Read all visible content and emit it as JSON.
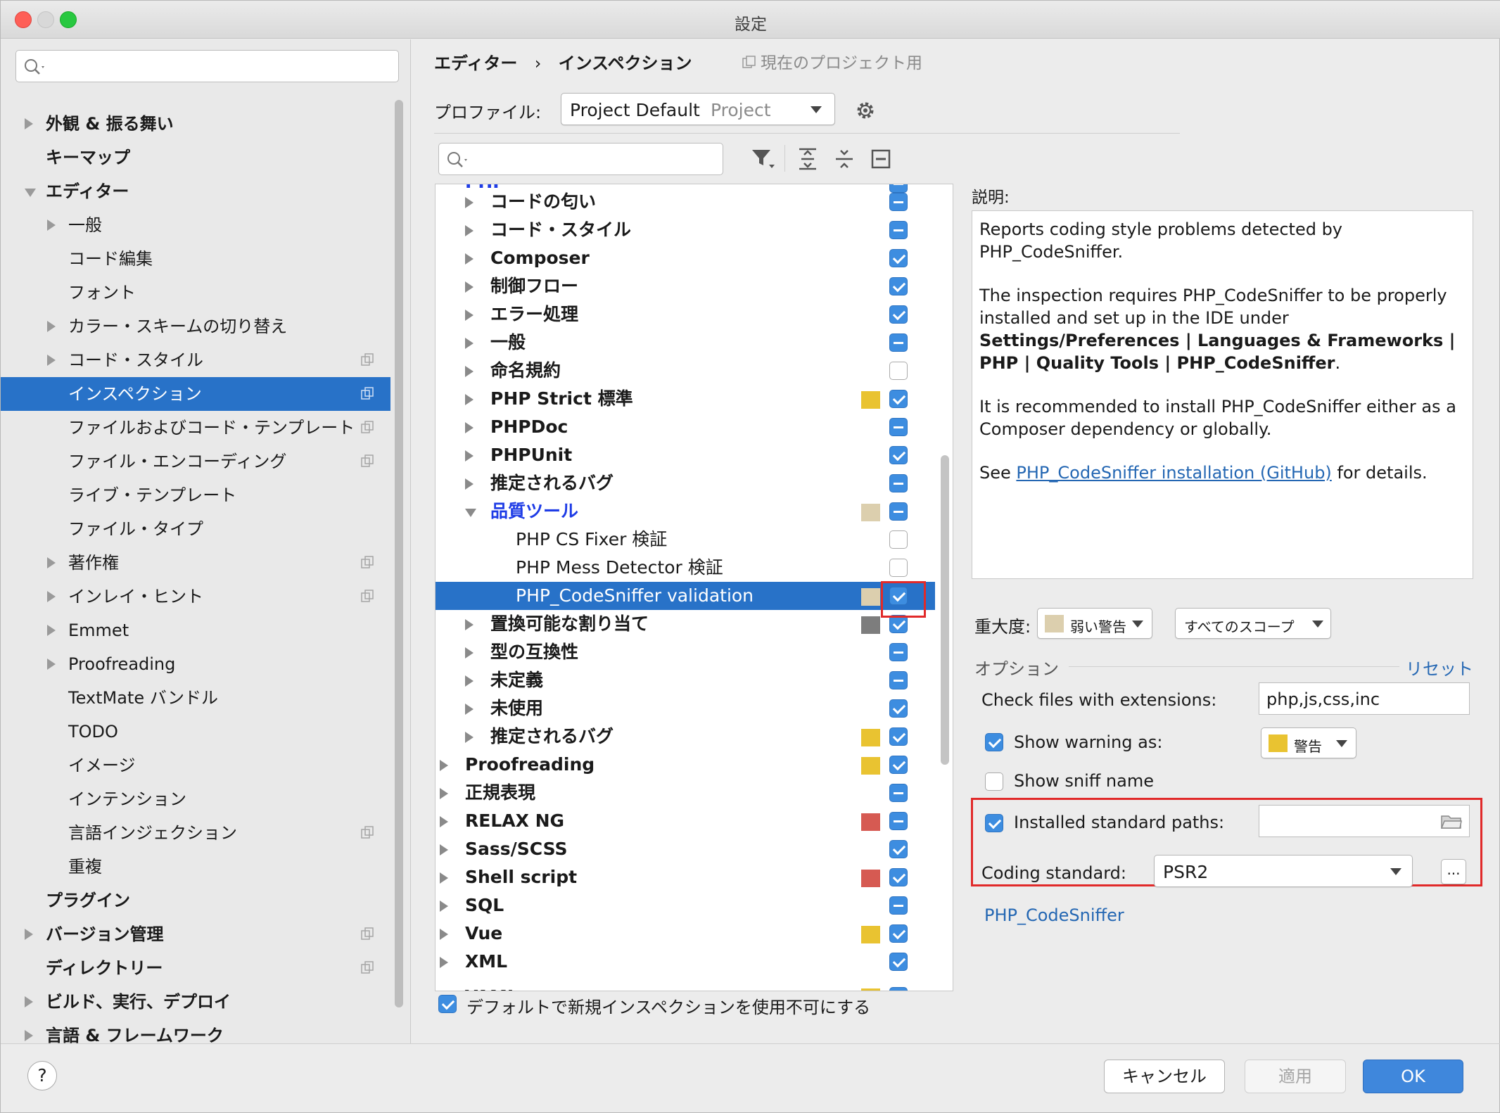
{
  "window": {
    "title": "設定"
  },
  "sidebar": {
    "search_placeholder": "",
    "items": [
      {
        "label": "外観 & 振る舞い",
        "bold": true,
        "indent": 0,
        "arrow": "closed",
        "proj": false
      },
      {
        "label": "キーマップ",
        "bold": true,
        "indent": 0,
        "arrow": "none",
        "proj": false
      },
      {
        "label": "エディター",
        "bold": true,
        "indent": 0,
        "arrow": "open",
        "proj": false
      },
      {
        "label": "一般",
        "bold": false,
        "indent": 1,
        "arrow": "closed",
        "proj": false
      },
      {
        "label": "コード編集",
        "bold": false,
        "indent": 1,
        "arrow": "none",
        "proj": false
      },
      {
        "label": "フォント",
        "bold": false,
        "indent": 1,
        "arrow": "none",
        "proj": false
      },
      {
        "label": "カラー・スキームの切り替え",
        "bold": false,
        "indent": 1,
        "arrow": "closed",
        "proj": false
      },
      {
        "label": "コード・スタイル",
        "bold": false,
        "indent": 1,
        "arrow": "closed",
        "proj": true
      },
      {
        "label": "インスペクション",
        "bold": false,
        "indent": 1,
        "arrow": "none",
        "proj": true,
        "selected": true
      },
      {
        "label": "ファイルおよびコード・テンプレート",
        "bold": false,
        "indent": 1,
        "arrow": "none",
        "proj": true
      },
      {
        "label": "ファイル・エンコーディング",
        "bold": false,
        "indent": 1,
        "arrow": "none",
        "proj": true
      },
      {
        "label": "ライブ・テンプレート",
        "bold": false,
        "indent": 1,
        "arrow": "none",
        "proj": false
      },
      {
        "label": "ファイル・タイプ",
        "bold": false,
        "indent": 1,
        "arrow": "none",
        "proj": false
      },
      {
        "label": "著作権",
        "bold": false,
        "indent": 1,
        "arrow": "closed",
        "proj": true
      },
      {
        "label": "インレイ・ヒント",
        "bold": false,
        "indent": 1,
        "arrow": "closed",
        "proj": true
      },
      {
        "label": "Emmet",
        "bold": false,
        "indent": 1,
        "arrow": "closed",
        "proj": false
      },
      {
        "label": "Proofreading",
        "bold": false,
        "indent": 1,
        "arrow": "closed",
        "proj": false
      },
      {
        "label": "TextMate バンドル",
        "bold": false,
        "indent": 1,
        "arrow": "none",
        "proj": false
      },
      {
        "label": "TODO",
        "bold": false,
        "indent": 1,
        "arrow": "none",
        "proj": false
      },
      {
        "label": "イメージ",
        "bold": false,
        "indent": 1,
        "arrow": "none",
        "proj": false
      },
      {
        "label": "インテンション",
        "bold": false,
        "indent": 1,
        "arrow": "none",
        "proj": false
      },
      {
        "label": "言語インジェクション",
        "bold": false,
        "indent": 1,
        "arrow": "none",
        "proj": true
      },
      {
        "label": "重複",
        "bold": false,
        "indent": 1,
        "arrow": "none",
        "proj": false
      },
      {
        "label": "プラグイン",
        "bold": true,
        "indent": 0,
        "arrow": "none",
        "proj": false
      },
      {
        "label": "バージョン管理",
        "bold": true,
        "indent": 0,
        "arrow": "closed",
        "proj": true
      },
      {
        "label": "ディレクトリー",
        "bold": true,
        "indent": 0,
        "arrow": "none",
        "proj": true
      },
      {
        "label": "ビルド、実行、デプロイ",
        "bold": true,
        "indent": 0,
        "arrow": "closed",
        "proj": false
      },
      {
        "label": "言語 & フレームワーク",
        "bold": true,
        "indent": 0,
        "arrow": "closed",
        "proj": false
      }
    ]
  },
  "header": {
    "crumb1": "エディター",
    "sep": "›",
    "crumb2": "インスペクション",
    "scope": "現在のプロジェクト用"
  },
  "profile": {
    "label": "プロファイル:",
    "value": "Project Default",
    "suffix": "Project"
  },
  "tree": {
    "rows": [
      {
        "label": "コードの匂い",
        "level": 1,
        "bold": true,
        "arrow": "closed",
        "sev": null,
        "cb": "mix"
      },
      {
        "label": "コード・スタイル",
        "level": 1,
        "bold": true,
        "arrow": "closed",
        "sev": null,
        "cb": "mix"
      },
      {
        "label": "Composer",
        "level": 1,
        "bold": true,
        "arrow": "closed",
        "sev": null,
        "cb": "on"
      },
      {
        "label": "制御フロー",
        "level": 1,
        "bold": true,
        "arrow": "closed",
        "sev": null,
        "cb": "on"
      },
      {
        "label": "エラー処理",
        "level": 1,
        "bold": true,
        "arrow": "closed",
        "sev": null,
        "cb": "on"
      },
      {
        "label": "一般",
        "level": 1,
        "bold": true,
        "arrow": "closed",
        "sev": null,
        "cb": "mix"
      },
      {
        "label": "命名規約",
        "level": 1,
        "bold": true,
        "arrow": "closed",
        "sev": null,
        "cb": "off"
      },
      {
        "label": "PHP Strict 標準",
        "level": 1,
        "bold": true,
        "arrow": "closed",
        "sev": "#e9c331",
        "cb": "on"
      },
      {
        "label": "PHPDoc",
        "level": 1,
        "bold": true,
        "arrow": "closed",
        "sev": null,
        "cb": "mix"
      },
      {
        "label": "PHPUnit",
        "level": 1,
        "bold": true,
        "arrow": "closed",
        "sev": null,
        "cb": "on"
      },
      {
        "label": "推定されるバグ",
        "level": 1,
        "bold": true,
        "arrow": "closed",
        "sev": null,
        "cb": "mix"
      },
      {
        "label": "品質ツール",
        "level": 1,
        "bold": true,
        "arrow": "open",
        "sev": "#dccfae",
        "cb": "mix",
        "color": "#1e3ce6"
      },
      {
        "label": "PHP CS Fixer 検証",
        "level": 2,
        "bold": false,
        "arrow": "none",
        "sev": null,
        "cb": "off"
      },
      {
        "label": "PHP Mess Detector 検証",
        "level": 2,
        "bold": false,
        "arrow": "none",
        "sev": null,
        "cb": "off"
      },
      {
        "label": "PHP_CodeSniffer validation",
        "level": 2,
        "bold": false,
        "arrow": "none",
        "sev": "#dccfae",
        "cb": "on",
        "selected": true
      },
      {
        "label": "置換可能な割り当て",
        "level": 1,
        "bold": true,
        "arrow": "closed",
        "sev": "#7d7d7d",
        "cb": "on"
      },
      {
        "label": "型の互換性",
        "level": 1,
        "bold": true,
        "arrow": "closed",
        "sev": null,
        "cb": "mix"
      },
      {
        "label": "未定義",
        "level": 1,
        "bold": true,
        "arrow": "closed",
        "sev": null,
        "cb": "mix"
      },
      {
        "label": "未使用",
        "level": 1,
        "bold": true,
        "arrow": "closed",
        "sev": null,
        "cb": "on"
      },
      {
        "label": "推定されるバグ",
        "level": 1,
        "bold": true,
        "arrow": "closed",
        "sev": "#e9c331",
        "cb": "on"
      },
      {
        "label": "Proofreading",
        "level": 0,
        "bold": true,
        "arrow": "closed",
        "sev": "#e9c331",
        "cb": "on"
      },
      {
        "label": "正規表現",
        "level": 0,
        "bold": true,
        "arrow": "closed",
        "sev": null,
        "cb": "mix"
      },
      {
        "label": "RELAX NG",
        "level": 0,
        "bold": true,
        "arrow": "closed",
        "sev": "#d65a52",
        "cb": "mix"
      },
      {
        "label": "Sass/SCSS",
        "level": 0,
        "bold": true,
        "arrow": "closed",
        "sev": null,
        "cb": "on"
      },
      {
        "label": "Shell script",
        "level": 0,
        "bold": true,
        "arrow": "closed",
        "sev": "#d65a52",
        "cb": "on"
      },
      {
        "label": "SQL",
        "level": 0,
        "bold": true,
        "arrow": "closed",
        "sev": null,
        "cb": "mix"
      },
      {
        "label": "Vue",
        "level": 0,
        "bold": true,
        "arrow": "closed",
        "sev": "#e9c331",
        "cb": "on"
      },
      {
        "label": "XML",
        "level": 0,
        "bold": true,
        "arrow": "closed",
        "sev": null,
        "cb": "on"
      }
    ],
    "footer_checkbox": "デフォルトで新規インスペクションを使用不可にする"
  },
  "description": {
    "label": "説明:",
    "p1": "Reports coding style problems detected by PHP_CodeSniffer.",
    "p2a": "The inspection requires PHP_CodeSniffer to be properly installed and set up in the IDE under ",
    "p2b": "Settings/Preferences | Languages & Frameworks | PHP | Quality Tools | PHP_CodeSniffer",
    "p2c": ".",
    "p3": "It is recommended to install PHP_CodeSniffer either as a Composer dependency or globally.",
    "p4a": "See ",
    "p4link": "PHP_CodeSniffer installation (GitHub)",
    "p4b": " for details."
  },
  "severity": {
    "label": "重大度:",
    "value": "弱い警告",
    "swatch": "#dccfae",
    "scope": "すべてのスコープ"
  },
  "options": {
    "label": "オプション",
    "reset": "リセット",
    "ext_label": "Check files with extensions:",
    "ext_value": "php,js,css,inc",
    "warn_label": "Show warning as:",
    "warn_value": "警告",
    "warn_swatch": "#e9c331",
    "sniff_label": "Show sniff name",
    "paths_label": "Installed standard paths:",
    "paths_value": "",
    "std_label": "Coding standard:",
    "std_value": "PSR2",
    "dots": "...",
    "link": "PHP_CodeSniffer"
  },
  "buttons": {
    "help": "?",
    "cancel": "キャンセル",
    "apply": "適用",
    "ok": "OK"
  },
  "colors": {
    "accent": "#2872c8",
    "highlight": "#e12a2a"
  }
}
